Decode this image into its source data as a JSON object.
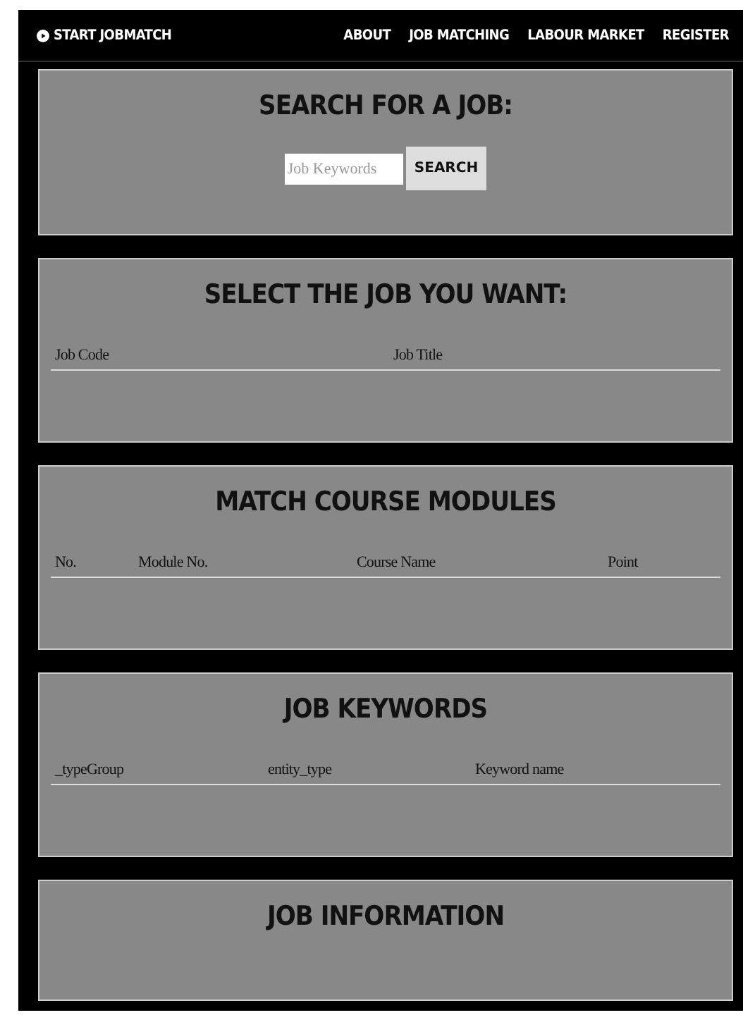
{
  "navbar": {
    "brand": "START JOBMATCH",
    "links": [
      "ABOUT",
      "JOB MATCHING",
      "LABOUR MARKET",
      "REGISTER"
    ]
  },
  "sections": [
    {
      "kind": "search",
      "title": "SEARCH FOR A JOB:",
      "placeholder": "Job Keywords",
      "button": "SEARCH"
    },
    {
      "kind": "table",
      "title": "SELECT THE JOB YOU WANT:",
      "columns": [
        "Job Code",
        "Job Title"
      ]
    },
    {
      "kind": "table",
      "title": "MATCH COURSE MODULES",
      "columns": [
        "No.",
        "Module No.",
        "Course Name",
        "Point"
      ]
    },
    {
      "kind": "table",
      "title": "JOB KEYWORDS",
      "columns": [
        "_typeGroup",
        "entity_type",
        "Keyword name"
      ]
    },
    {
      "kind": "info",
      "title": "JOB INFORMATION"
    }
  ]
}
